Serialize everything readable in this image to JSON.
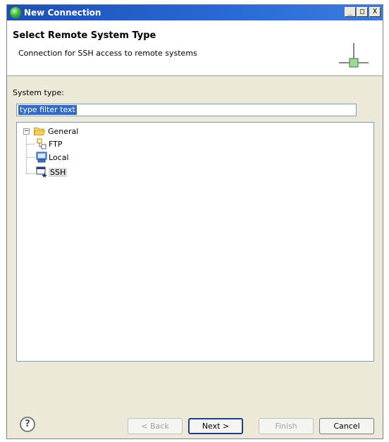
{
  "window": {
    "title": "New Connection",
    "minimize": "_",
    "maximize": "□",
    "close": "X"
  },
  "header": {
    "title": "Select Remote System Type",
    "description": "Connection for SSH access to remote systems"
  },
  "system_type_label": "System type:",
  "filter": {
    "value": "type filter text"
  },
  "tree": {
    "expander": "−",
    "root": "General",
    "children": [
      {
        "label": "FTP",
        "icon": "ftp-icon"
      },
      {
        "label": "Local",
        "icon": "local-computer-icon"
      },
      {
        "label": "SSH",
        "icon": "ssh-icon",
        "selected": true
      }
    ]
  },
  "buttons": {
    "help": "?",
    "back": "< Back",
    "next": "Next >",
    "finish": "Finish",
    "cancel": "Cancel"
  }
}
